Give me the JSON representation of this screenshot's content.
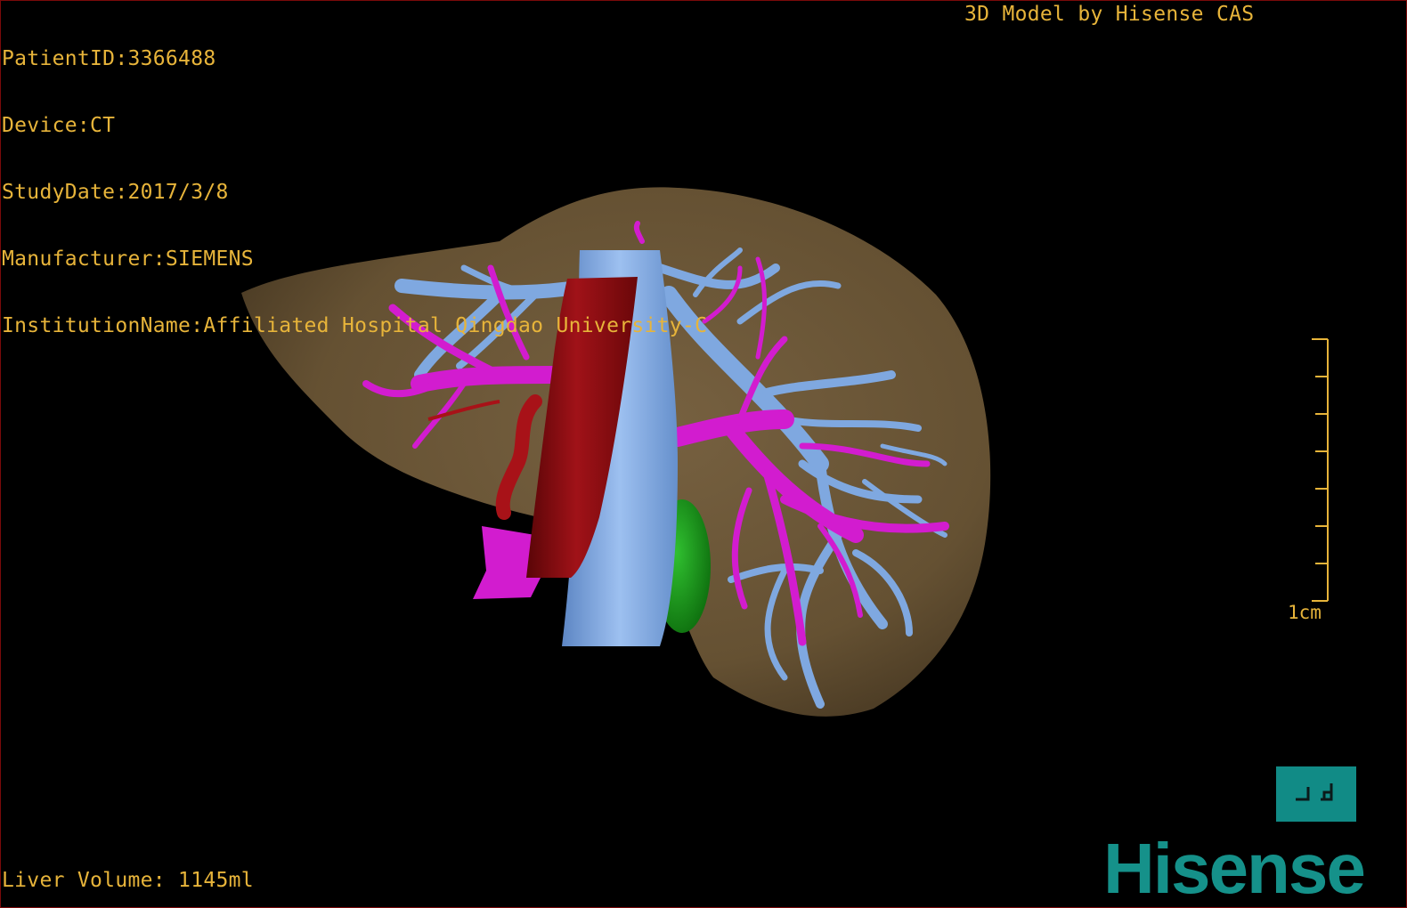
{
  "patient_info": [
    "PatientID:3366488",
    "Device:CT",
    "StudyDate:2017/3/8",
    "Manufacturer:SIEMENS",
    "InstitutionName:Affiliated Hospital Qingdao University-C"
  ],
  "model_credit": "3D Model by Hisense CAS",
  "liver_volume": "Liver Volume: 1145ml",
  "scale_bar_label": "1cm",
  "brand_logo_text": "Hisense",
  "orientation_icon": "lp-orientation-icon",
  "colors": {
    "overlay_text": "#e7b43a",
    "liver": "#6f5a3a",
    "vein_blue": "#7fa8e0",
    "portal_magenta": "#d21ccf",
    "ivc_red": "#8a0c10",
    "gallbladder_green": "#1c9a1c",
    "brand_teal": "#15918a"
  }
}
